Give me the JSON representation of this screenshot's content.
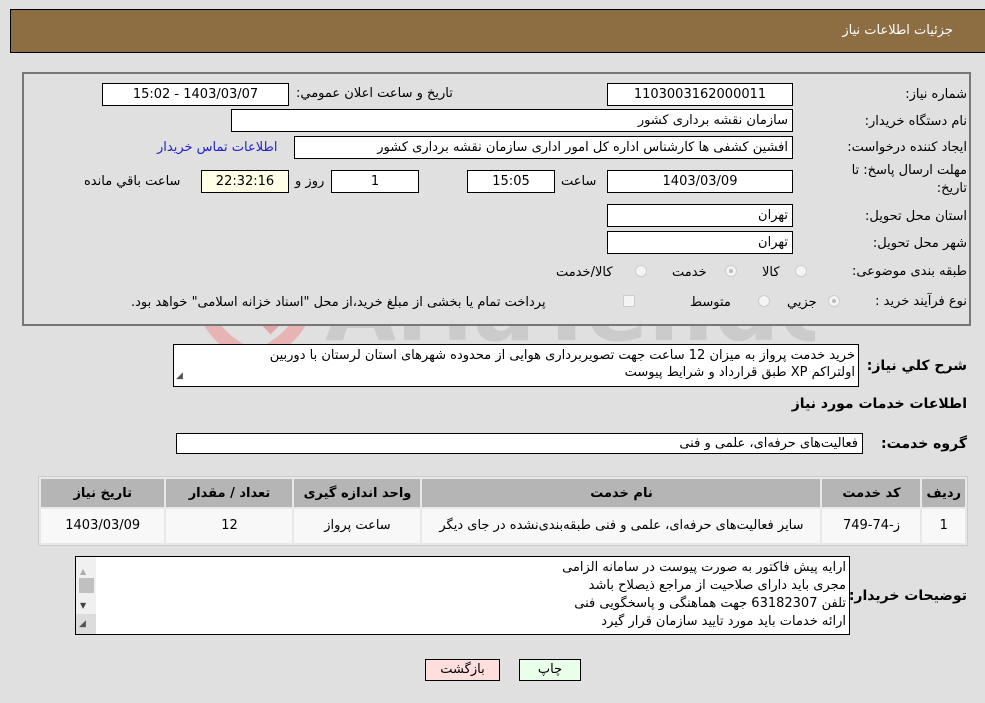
{
  "header": {
    "title": "جزئیات اطلاعات نیاز"
  },
  "form": {
    "need_number": {
      "label": "شماره نیاز:",
      "value": "1103003162000011"
    },
    "announce_datetime": {
      "label": "تاریخ و ساعت اعلان عمومي:",
      "value": "1403/03/07 - 15:02"
    },
    "buyer_org": {
      "label": "نام دستگاه خریدار:",
      "value": "سازمان نقشه برداری کشور"
    },
    "requester": {
      "label": "ایجاد کننده درخواست:",
      "value": "افشین کشفی ها کارشناس اداره کل امور اداری سازمان نقشه برداری کشور",
      "contact_link": "اطلاعات تماس خریدار"
    },
    "deadline": {
      "label_line1": "مهلت ارسال پاسخ: تا",
      "label_line2": "تاریخ:",
      "date": "1403/03/09",
      "time_label": "ساعت",
      "time": "15:05",
      "days": "1",
      "days_label": "روز و",
      "remaining": "22:32:16",
      "remaining_label": "ساعت باقي مانده"
    },
    "province": {
      "label": "استان محل تحویل:",
      "value": "تهران"
    },
    "city": {
      "label": "شهر محل تحویل:",
      "value": "تهران"
    },
    "category": {
      "label": "طبقه بندی موضوعی:",
      "options": [
        {
          "label": "کالا",
          "checked": false
        },
        {
          "label": "خدمت",
          "checked": true
        },
        {
          "label": "کالا/خدمت",
          "checked": false
        }
      ]
    },
    "process_type": {
      "label": "نوع فرآیند خرید :",
      "options": [
        {
          "label": "جزيي",
          "checked": true
        },
        {
          "label": "متوسط",
          "checked": false
        }
      ],
      "payment_note": "پرداخت تمام یا بخشی از مبلغ خرید،از محل \"اسناد خزانه اسلامی\" خواهد بود."
    }
  },
  "description": {
    "label": "شرح كلي نياز:",
    "value_line1": "خرید خدمت پرواز به میزان 12 ساعت جهت تصویربرداری هوایی از محدوده شهرهای استان لرستان با دوربین",
    "value_line2": "اولتراکم XP طبق قرارداد و شرایط پیوست"
  },
  "services_section": {
    "title": "اطلاعات خدمات مورد نياز"
  },
  "service_group": {
    "label": "گروه خدمت:",
    "value": "فعالیت‌های حرفه‌ای، علمی و فنی"
  },
  "table": {
    "headers": [
      "رديف",
      "کد خدمت",
      "نام خدمت",
      "واحد اندازه گيری",
      "تعداد / مقدار",
      "تاريخ نياز"
    ],
    "rows": [
      [
        "1",
        "ز-74-749",
        "سایر فعالیت‌های حرفه‌ای، علمی و فنی طبقه‌بندی‌نشده در جای دیگر",
        "ساعت پرواز",
        "12",
        "1403/03/09"
      ]
    ]
  },
  "buyer_notes": {
    "label": "توضيحات خريدار:",
    "lines": [
      "ارایه پیش فاکتور به صورت پیوست در سامانه الزامی",
      "مجری باید دارای صلاحیت از مراجع ذیصلاح باشد",
      "تلفن 63182307  جهت هماهنگی و پاسخگویی فنی",
      "ارائه خدمات باید مورد تایید سازمان قرار گیرد"
    ]
  },
  "buttons": {
    "print": "چاپ",
    "back": "بازگشت"
  },
  "watermark": {
    "text": "AriaTender.neT"
  },
  "colors": {
    "header_bg": "#8d6e42",
    "print_btn_bg": "#eaffea",
    "back_btn_bg": "#ffdede",
    "link": "#2222cc",
    "remaining_bg": "#ffffe8"
  }
}
